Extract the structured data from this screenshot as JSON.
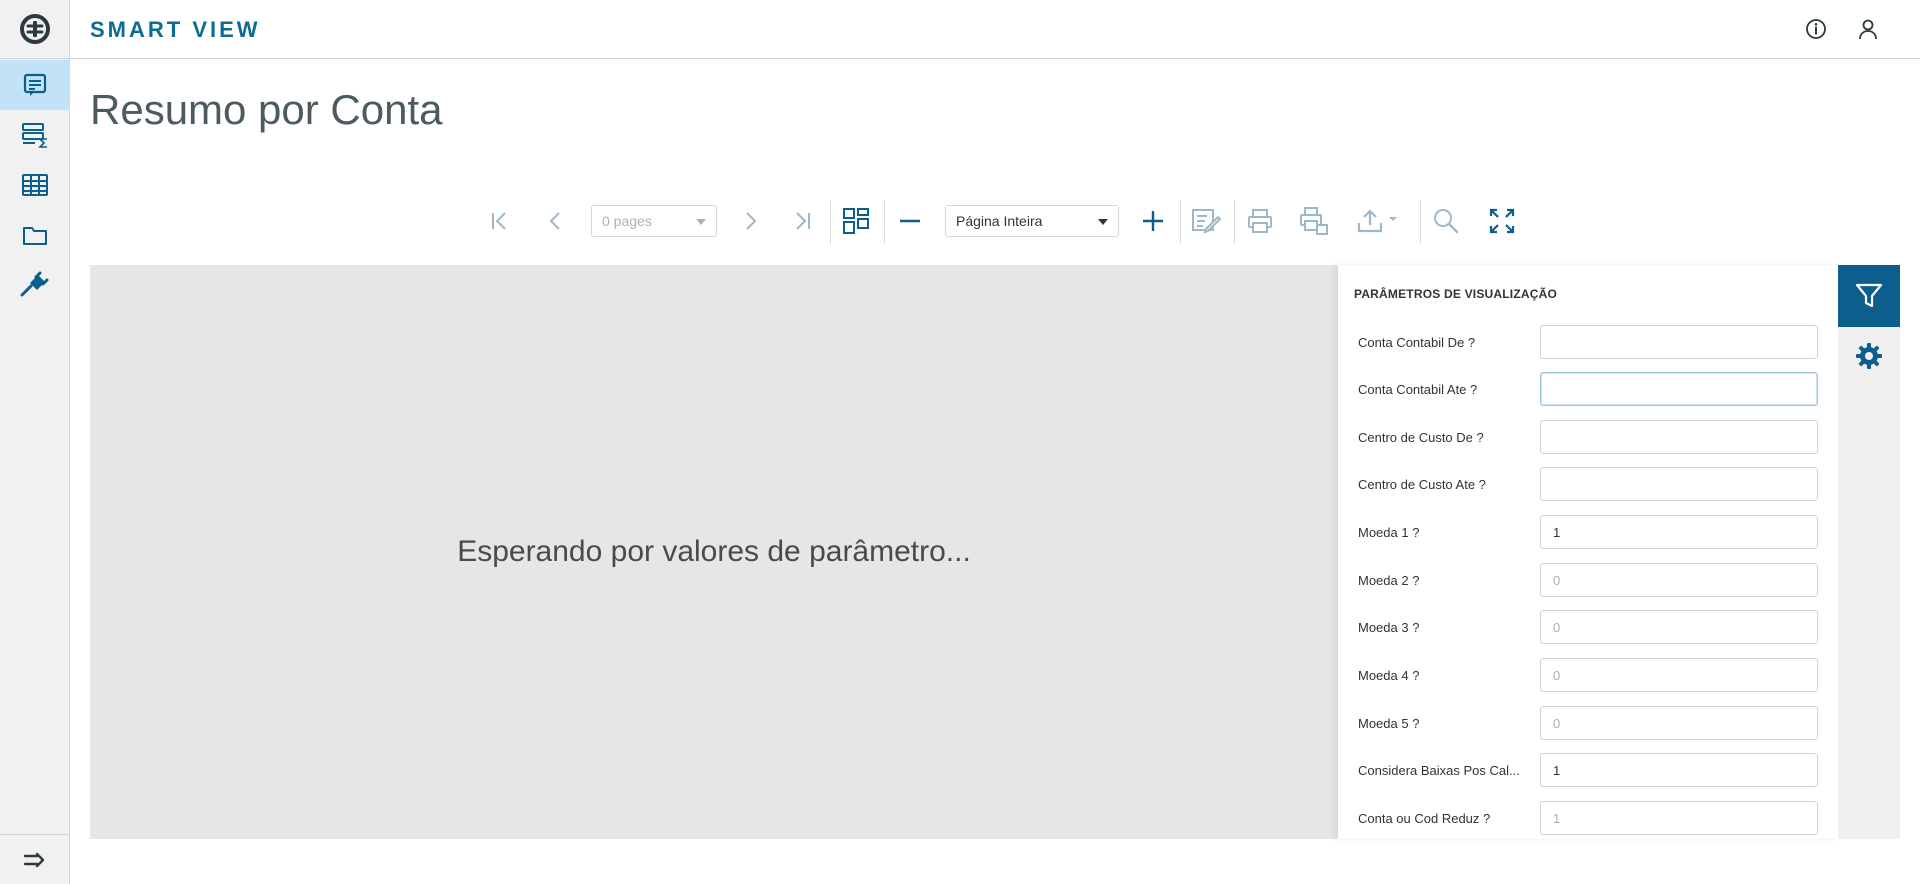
{
  "app": {
    "brand": "SMART VIEW"
  },
  "page": {
    "title": "Resumo por Conta"
  },
  "toolbar": {
    "pages_select": "0 pages",
    "zoom_select": "Página Inteira"
  },
  "viewer": {
    "message": "Esperando por valores de parâmetro..."
  },
  "params": {
    "title": "PARÂMETROS DE VISUALIZAÇÃO",
    "fields": [
      {
        "label": "Conta Contabil De ?",
        "value": "",
        "placeholder": ""
      },
      {
        "label": "Conta Contabil Ate ?",
        "value": "",
        "placeholder": ""
      },
      {
        "label": "Centro de Custo De ?",
        "value": "",
        "placeholder": ""
      },
      {
        "label": "Centro de Custo Ate ?",
        "value": "",
        "placeholder": ""
      },
      {
        "label": "Moeda 1 ?",
        "value": "1",
        "placeholder": ""
      },
      {
        "label": "Moeda 2 ?",
        "value": "",
        "placeholder": "0"
      },
      {
        "label": "Moeda 3 ?",
        "value": "",
        "placeholder": "0"
      },
      {
        "label": "Moeda 4 ?",
        "value": "",
        "placeholder": "0"
      },
      {
        "label": "Moeda 5 ?",
        "value": "",
        "placeholder": "0"
      },
      {
        "label": "Considera Baixas Pos Cal...",
        "value": "1",
        "placeholder": ""
      },
      {
        "label": "Conta ou Cod Reduz ?",
        "value": "",
        "placeholder": "1"
      }
    ]
  },
  "icons": {
    "rail": [
      "logo-icon",
      "report-icon",
      "sum-list-icon",
      "table-icon",
      "folder-icon",
      "plug-icon",
      "expand-menu-icon"
    ],
    "header": [
      "info-icon",
      "user-icon"
    ],
    "toolbar": [
      "first-page-icon",
      "prev-page-icon",
      "next-page-icon",
      "last-page-icon",
      "thumbnails-icon",
      "zoom-out-icon",
      "zoom-in-icon",
      "edit-icon",
      "print-icon",
      "print-preview-icon",
      "export-icon",
      "search-icon",
      "fullscreen-icon"
    ],
    "right_tabs": [
      "filter-icon",
      "settings-icon"
    ]
  },
  "colors": {
    "brand": "#0c6c94",
    "active_tab": "#0c5f8c",
    "rail_active": "#c2e3f7",
    "icon_active": "#0c5f8c",
    "icon_disabled": "#9fb8c8"
  }
}
